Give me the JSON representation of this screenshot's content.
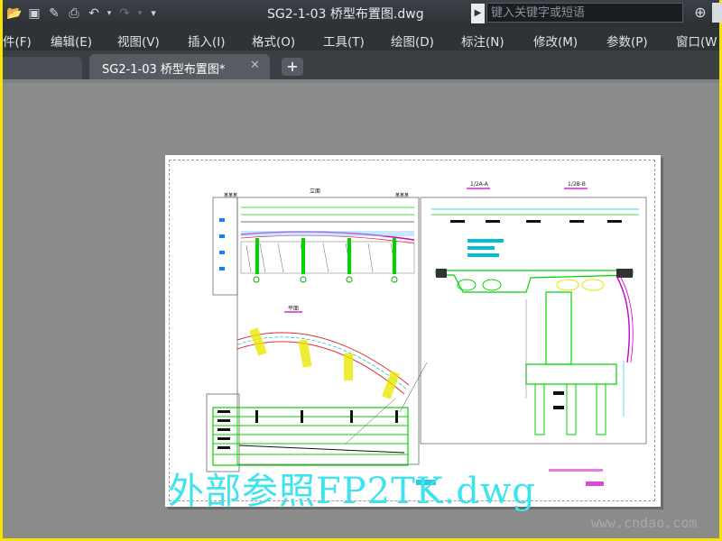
{
  "window": {
    "title": "SG2-1-03 桥型布置图.dwg",
    "search_placeholder": "键入关键字或短语"
  },
  "quick_access": {
    "icons": [
      "open-icon",
      "save-icon",
      "save-as-icon",
      "print-icon",
      "undo-icon",
      "undo-dropdown-icon",
      "redo-icon",
      "redo-dropdown-icon",
      "customize-dropdown-icon"
    ]
  },
  "menu": {
    "items": [
      "件(F)",
      "编辑(E)",
      "视图(V)",
      "插入(I)",
      "格式(O)",
      "工具(T)",
      "绘图(D)",
      "标注(N)",
      "修改(M)",
      "参数(P)",
      "窗口(W"
    ]
  },
  "tabs": {
    "active_label": "SG2-1-03 桥型布置图*",
    "close_symbol": "✕",
    "add_symbol": "+"
  },
  "drawing": {
    "xref_text": "外部参照FP2TK.dwg",
    "watermark": "www.cndao.com"
  },
  "colors": {
    "accent_yellow": "#f2e700",
    "workspace_gray": "#8b8b8b",
    "xref_cyan": "#3ee3ee",
    "line_green": "#00d400",
    "line_magenta": "#c800c8"
  }
}
